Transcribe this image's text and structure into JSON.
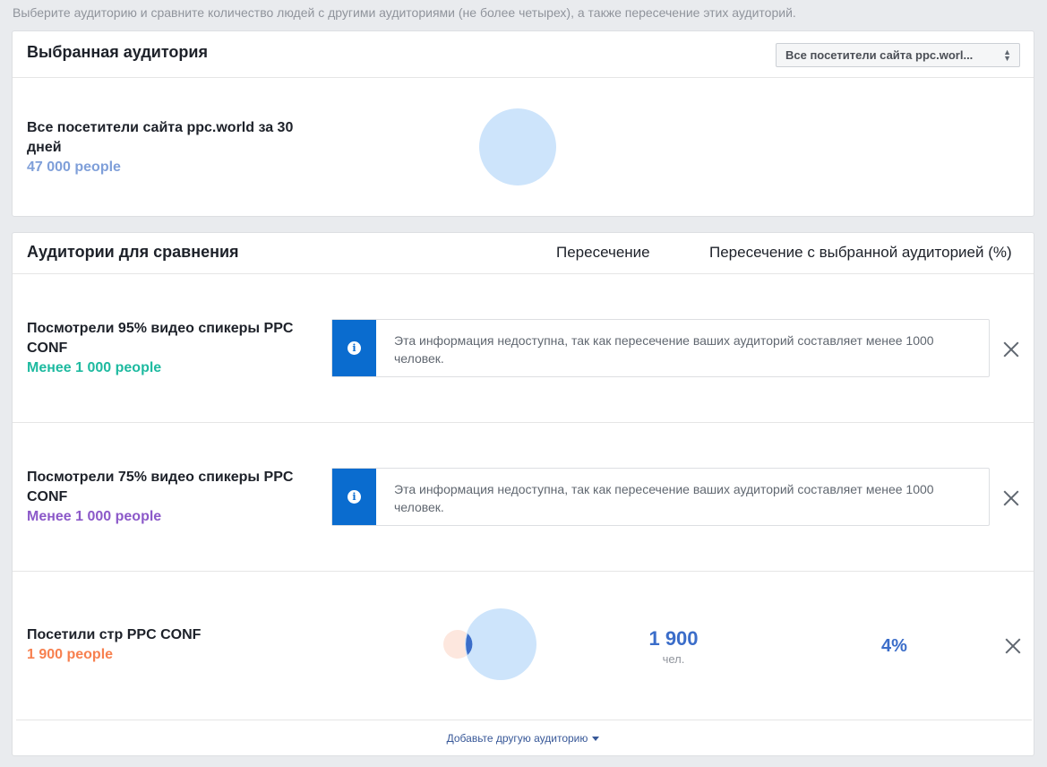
{
  "intro": "Выберите аудиторию и сравните количество людей с другими аудиториями (не более четырех), а также пересечение этих аудиторий.",
  "selected": {
    "title": "Выбранная аудитория",
    "select_value": "Все посетители сайта ppc.worl...",
    "audience_name": "Все посетители сайта ppc.world за 30 дней",
    "audience_size": "47 000 people",
    "colors": {
      "circle": "#cde4fb",
      "size_text": "#7f9fd9"
    }
  },
  "comparison": {
    "title": "Аудитории для сравнения",
    "col_overlap": "Пересечение",
    "col_overlap_pct": "Пересечение с выбранной аудиторией (%)",
    "rows": [
      {
        "name": "Посмотрели 95% видео спикеры PPC CONF",
        "size": "Менее 1 000 people",
        "color": "#1ebaa0",
        "notice": "Эта информация недоступна, так как пересечение ваших аудиторий составляет менее 1000 человек."
      },
      {
        "name": "Посмотрели 75% видео спикеры PPC CONF",
        "size": "Менее 1 000 people",
        "color": "#8c59c9",
        "notice": "Эта информация недоступна, так как пересечение ваших аудиторий составляет менее 1000 человек."
      },
      {
        "name": "Посетили стр PPC CONF",
        "size": "1 900 people",
        "color": "#f7804f",
        "overlap_value": "1 900",
        "overlap_unit": "чел.",
        "overlap_pct": "4%"
      }
    ],
    "add_link": "Добавьте другую аудиторию"
  },
  "icons": {
    "info": "info-icon",
    "close": "close-icon",
    "dropdown": "chevron-down-icon"
  }
}
